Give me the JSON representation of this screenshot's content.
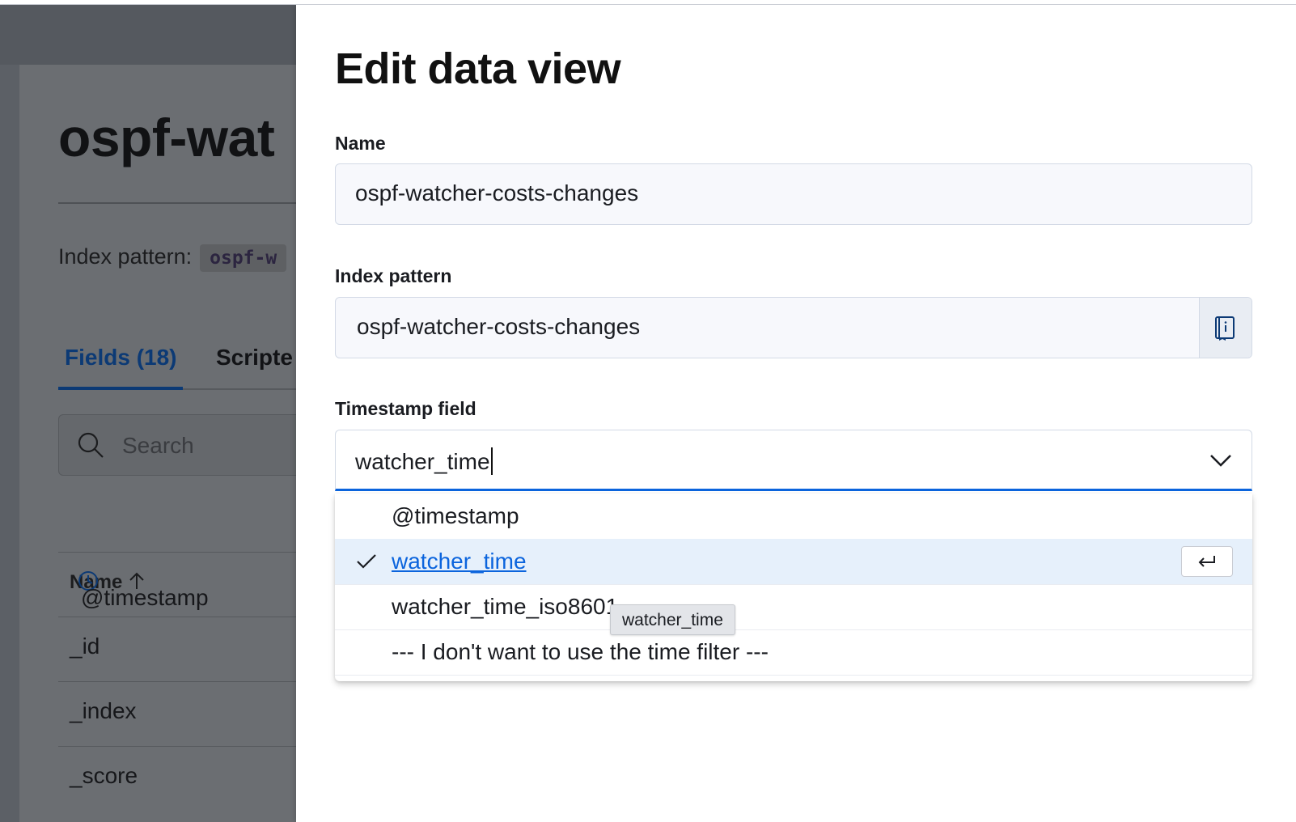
{
  "background_page": {
    "title": "ospf-wat",
    "index_pattern_label": "Index pattern:",
    "index_pattern_value": "ospf-w",
    "tabs": [
      {
        "label": "Fields (18)",
        "active": true
      },
      {
        "label": "Scripte",
        "active": false
      }
    ],
    "search_placeholder": "Search",
    "table": {
      "name_column": "Name",
      "rows": [
        "@timestamp",
        "_id",
        "_index",
        "_score"
      ]
    }
  },
  "flyout": {
    "title": "Edit data view",
    "name": {
      "label": "Name",
      "value": "ospf-watcher-costs-changes"
    },
    "index_pattern": {
      "label": "Index pattern",
      "value": "ospf-watcher-costs-changes",
      "help_icon": "book-info-icon"
    },
    "timestamp": {
      "label": "Timestamp field",
      "value": "watcher_time",
      "options": [
        {
          "label": "@timestamp",
          "selected": false
        },
        {
          "label": "watcher_time",
          "selected": true
        },
        {
          "label": "watcher_time_iso8601",
          "selected": false
        },
        {
          "label": "--- I don't want to use the time filter ---",
          "selected": false
        }
      ],
      "tooltip": "watcher_time"
    }
  },
  "colors": {
    "accent": "#0b64dd",
    "selected_row": "#e6f0fb",
    "tab_active": "#0c3a75",
    "overlay": "#5c6066"
  }
}
